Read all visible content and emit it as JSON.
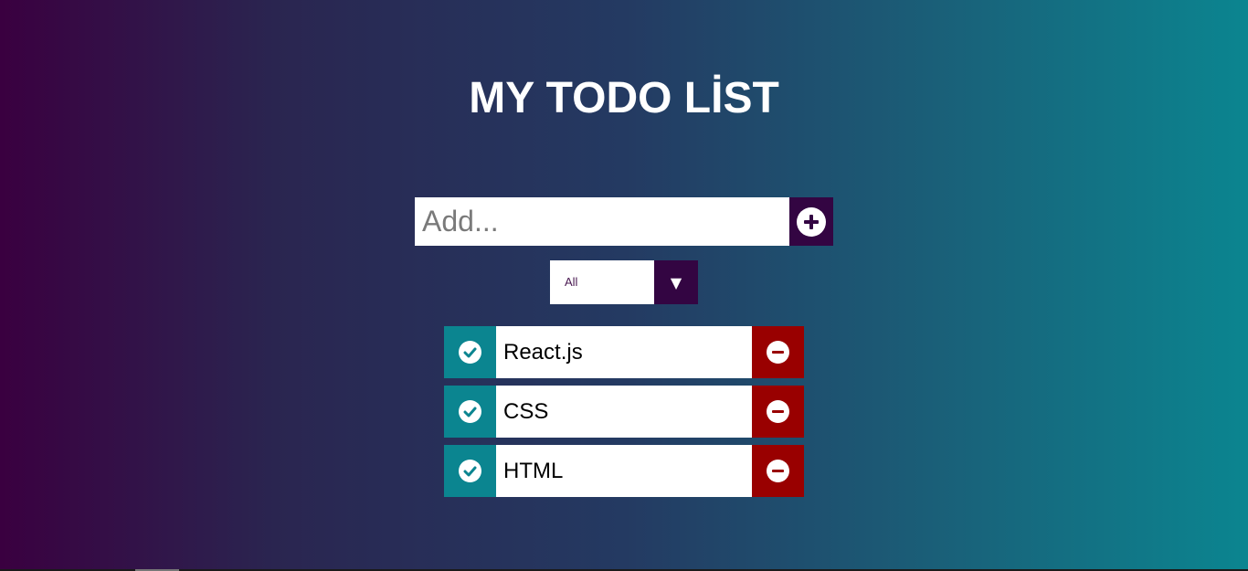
{
  "title": "MY TODO LİST",
  "add_form": {
    "placeholder": "Add...",
    "value": "",
    "add_icon": "plus-circle-icon"
  },
  "filter": {
    "selected": "All",
    "arrow": "▼"
  },
  "todos": [
    {
      "text": "React.js",
      "check_icon": "check-circle-icon",
      "delete_icon": "minus-circle-icon"
    },
    {
      "text": "CSS",
      "check_icon": "check-circle-icon",
      "delete_icon": "minus-circle-icon"
    },
    {
      "text": "HTML",
      "check_icon": "check-circle-icon",
      "delete_icon": "minus-circle-icon"
    }
  ],
  "colors": {
    "accent_dark": "#330542",
    "check": "#0b8590",
    "delete": "#990000"
  }
}
